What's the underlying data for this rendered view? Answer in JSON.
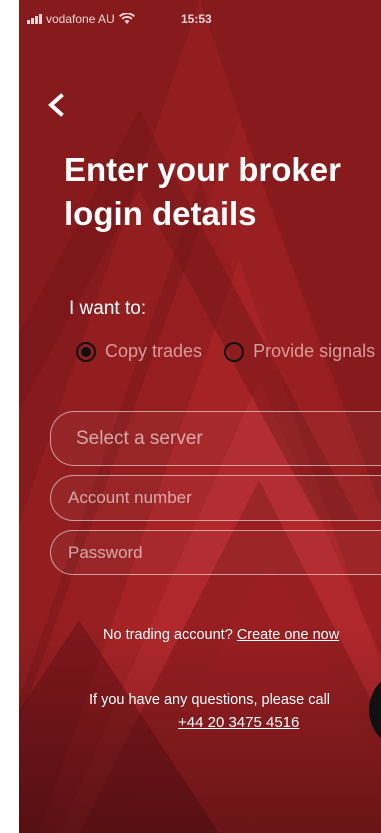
{
  "status_bar": {
    "carrier": "vodafone AU",
    "time": "15:53"
  },
  "header": {
    "title": "Enter your broker\nlogin details"
  },
  "mode": {
    "label": "I want to:",
    "options": [
      {
        "label": "Copy trades",
        "selected": true
      },
      {
        "label": "Provide signals",
        "selected": false
      }
    ]
  },
  "form": {
    "server_placeholder": "Select a server",
    "account_placeholder": "Account number",
    "password_placeholder": "Password"
  },
  "footer": {
    "no_account_text": "No trading account?",
    "create_link": "Create one now",
    "help_text": "If you have any questions, please call",
    "phone": "+44 20 3475 4516"
  },
  "colors": {
    "background": "#8a1a1c",
    "accent": "#c62828"
  }
}
